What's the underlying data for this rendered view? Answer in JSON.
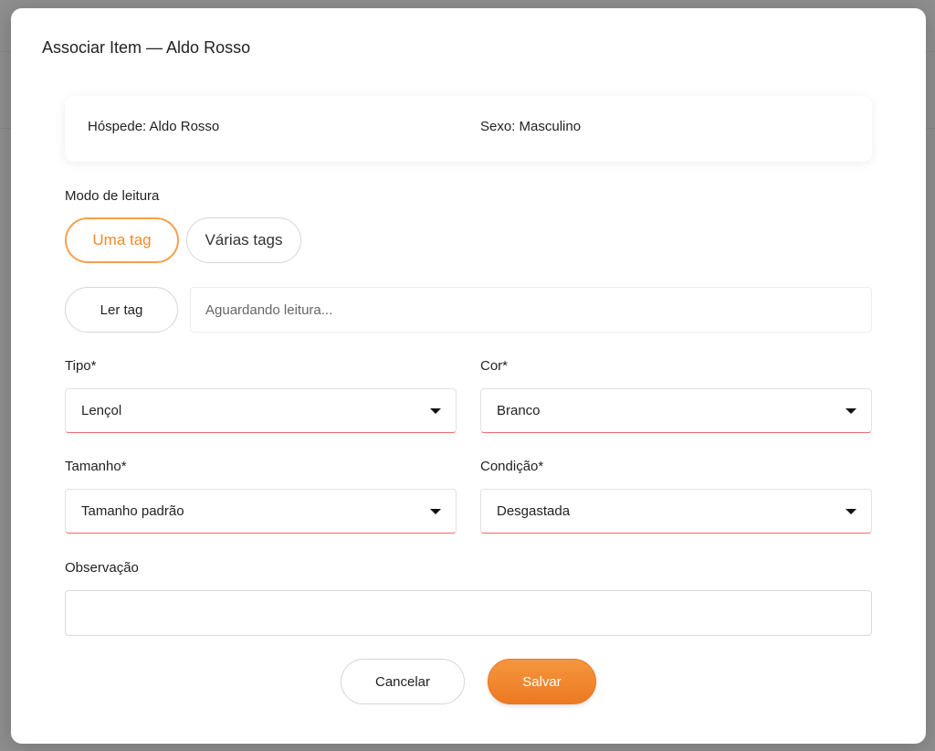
{
  "modal": {
    "title": "Associar Item — Aldo Rosso"
  },
  "guest_card": {
    "guest": "Hóspede: Aldo Rosso",
    "sex": "Sexo: Masculino"
  },
  "reading_mode": {
    "label": "Modo de leitura",
    "options": [
      {
        "label": "Uma tag",
        "selected": true
      },
      {
        "label": "Várias tags",
        "selected": false
      }
    ]
  },
  "tag_reader": {
    "button_label": "Ler tag",
    "placeholder": "Aguardando leitura..."
  },
  "fields": {
    "tipo": {
      "label": "Tipo*",
      "value": "Lençol"
    },
    "cor": {
      "label": "Cor*",
      "value": "Branco"
    },
    "tamanho": {
      "label": "Tamanho*",
      "value": "Tamanho padrão"
    },
    "condicao": {
      "label": "Condição*",
      "value": "Desgastada"
    },
    "observacao": {
      "label": "Observação",
      "value": ""
    }
  },
  "actions": {
    "cancel_label": "Cancelar",
    "save_label": "Salvar"
  },
  "colors": {
    "accent": "#f18a2d",
    "save_button": "#ef832d",
    "invalid_underline": "#ef6a6a",
    "overlay": "#8e8e8e"
  }
}
